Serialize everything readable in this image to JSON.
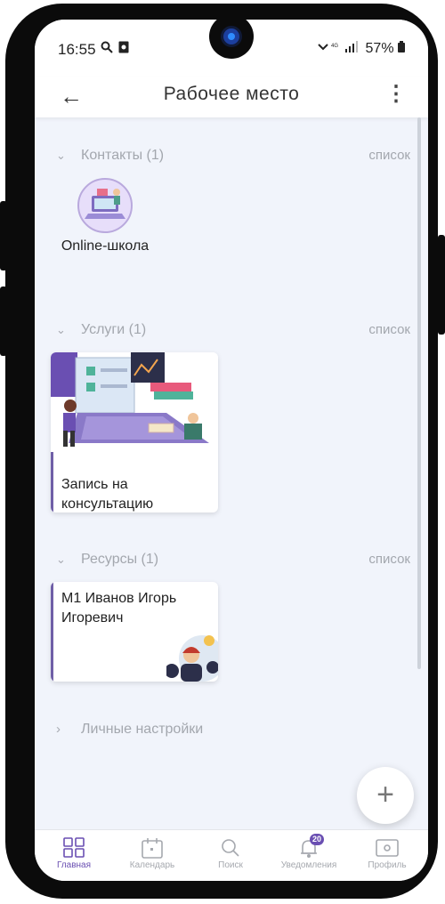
{
  "status": {
    "time": "16:55",
    "right": "57%"
  },
  "appbar": {
    "title": "Рабочее место"
  },
  "sections": {
    "contacts": {
      "label": "Контакты (1)",
      "list": "список"
    },
    "services": {
      "label": "Услуги (1)",
      "list": "список"
    },
    "resources": {
      "label": "Ресурсы (1)",
      "list": "список"
    },
    "settings": {
      "label": "Личные настройки"
    }
  },
  "contact": {
    "name": "Online-школа"
  },
  "service_card": {
    "title": "Запись на консультацию"
  },
  "resource_card": {
    "title": "М1 Иванов Игорь Игоревич"
  },
  "fab": {
    "label": "+"
  },
  "tabs": [
    {
      "label": "Главная",
      "icon": "grid-icon"
    },
    {
      "label": "Календарь",
      "icon": "calendar-icon"
    },
    {
      "label": "Поиск",
      "icon": "search-icon"
    },
    {
      "label": "Уведомления",
      "icon": "bell-icon",
      "badge": "20"
    },
    {
      "label": "Профиль",
      "icon": "profile-icon"
    }
  ],
  "colors": {
    "accent": "#6a4fb2",
    "background": "#f1f4fb",
    "muted": "#a3a7ae"
  }
}
